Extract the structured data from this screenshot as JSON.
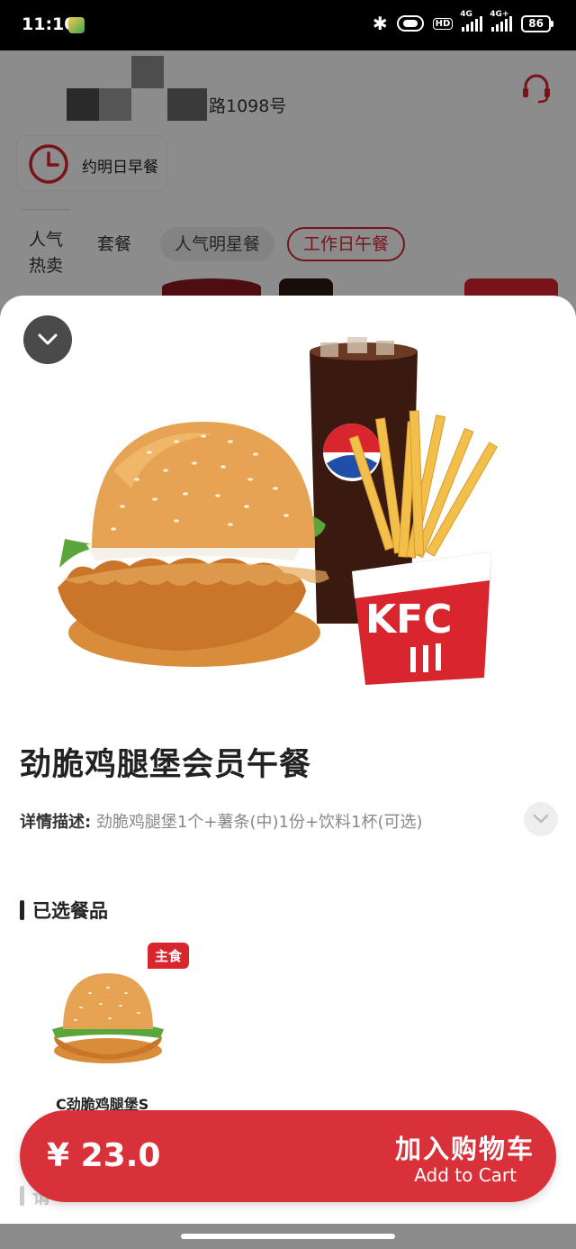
{
  "status_bar": {
    "time": "11:10",
    "net1": "4G",
    "net2": "4G+",
    "hd": "HD",
    "battery": "86"
  },
  "background": {
    "address": "路1098号",
    "reserve_label": "约明日早餐",
    "side_category": "人气热卖",
    "tabs": [
      "套餐",
      "人气明星餐",
      "工作日午餐"
    ],
    "active_tab_index": 2
  },
  "product": {
    "title": "劲脆鸡腿堡会员午餐",
    "detail_label": "详情描述:",
    "detail_text": "劲脆鸡腿堡1个+薯条(中)1份+饮料1杯(可选)",
    "section_selected": "已选餐品",
    "items": [
      {
        "tag": "主食",
        "name": "C劲脆鸡腿堡S"
      }
    ],
    "next_section": "请"
  },
  "cart": {
    "price": "¥ 23.0",
    "add_cn": "加入购物车",
    "add_en": "Add to Cart"
  },
  "colors": {
    "accent": "#d9313a",
    "tag": "#d9262e"
  }
}
